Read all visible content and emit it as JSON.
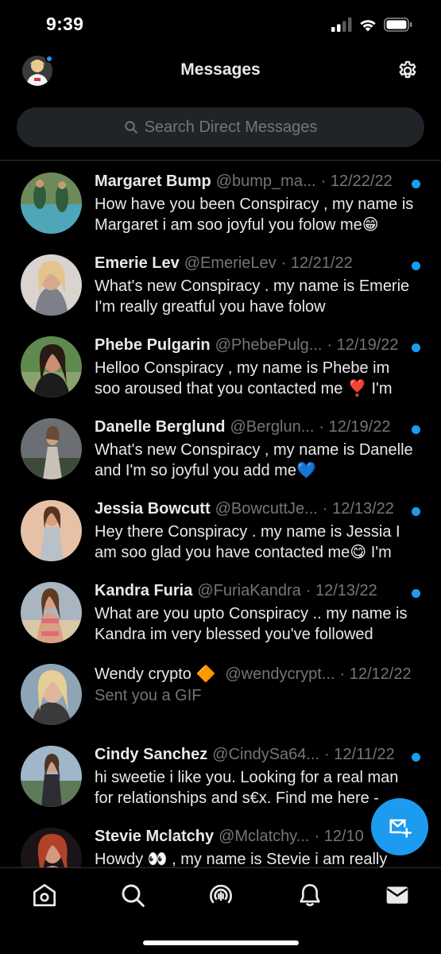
{
  "status_bar": {
    "time": "9:39"
  },
  "header": {
    "title": "Messages"
  },
  "search": {
    "placeholder": "Search Direct Messages"
  },
  "conversations": [
    {
      "name": "Margaret Bump",
      "handle": "@bump_ma...",
      "date": "· 12/22/22",
      "unread": true,
      "preview": "How have you been Conspiracy , my name is Margaret i am soo joyful you folow me😁"
    },
    {
      "name": "Emerie Lev",
      "handle": "@EmerieLev",
      "date": "· 12/21/22",
      "unread": true,
      "preview": "What's new Conspiracy . my name is Emerie I'm really greatful you have folow"
    },
    {
      "name": "Phebe Pulgarin",
      "handle": "@PhebePulg...",
      "date": "· 12/19/22",
      "unread": true,
      "preview": "Helloo Conspiracy , my name is Phebe im soo aroused that you contacted me ❣️ I'm"
    },
    {
      "name": "Danelle Berglund",
      "handle": "@Berglun...",
      "date": "· 12/19/22",
      "unread": true,
      "preview": "What's new Conspiracy , my name is Danelle and I'm so joyful you add me💙"
    },
    {
      "name": "Jessia Bowcutt",
      "handle": "@BowcuttJe...",
      "date": "· 12/13/22",
      "unread": true,
      "preview": "Hey there Conspiracy . my name is Jessia I am soo glad you have contacted me😋 I'm"
    },
    {
      "name": "Kandra Furia",
      "handle": "@FuriaKandra",
      "date": "· 12/13/22",
      "unread": true,
      "preview": "What are you upto Conspiracy .. my name is Kandra im very blessed you've followed"
    },
    {
      "name": "Wendy crypto 🔶",
      "handle": "@wendycrypt...",
      "date": "· 12/12/22",
      "unread": false,
      "preview": "Sent you a GIF"
    },
    {
      "name": "Cindy Sanchez",
      "handle": "@CindySa64...",
      "date": "· 12/11/22",
      "unread": true,
      "preview": "hi sweetie i like you. Looking for a real man for relationships and s€x. Find me here -"
    },
    {
      "name": "Stevie Mclatchy",
      "handle": "@Mclatchy...",
      "date": "· 12/10",
      "unread": false,
      "preview": "Howdy 👀 , my name is Stevie i am really"
    }
  ],
  "colors": {
    "accent": "#1d9bf0",
    "background": "#000000",
    "secondary_text": "#71767b"
  },
  "tabs": [
    "home-icon",
    "search-icon",
    "spaces-icon",
    "notifications-icon",
    "messages-icon"
  ]
}
